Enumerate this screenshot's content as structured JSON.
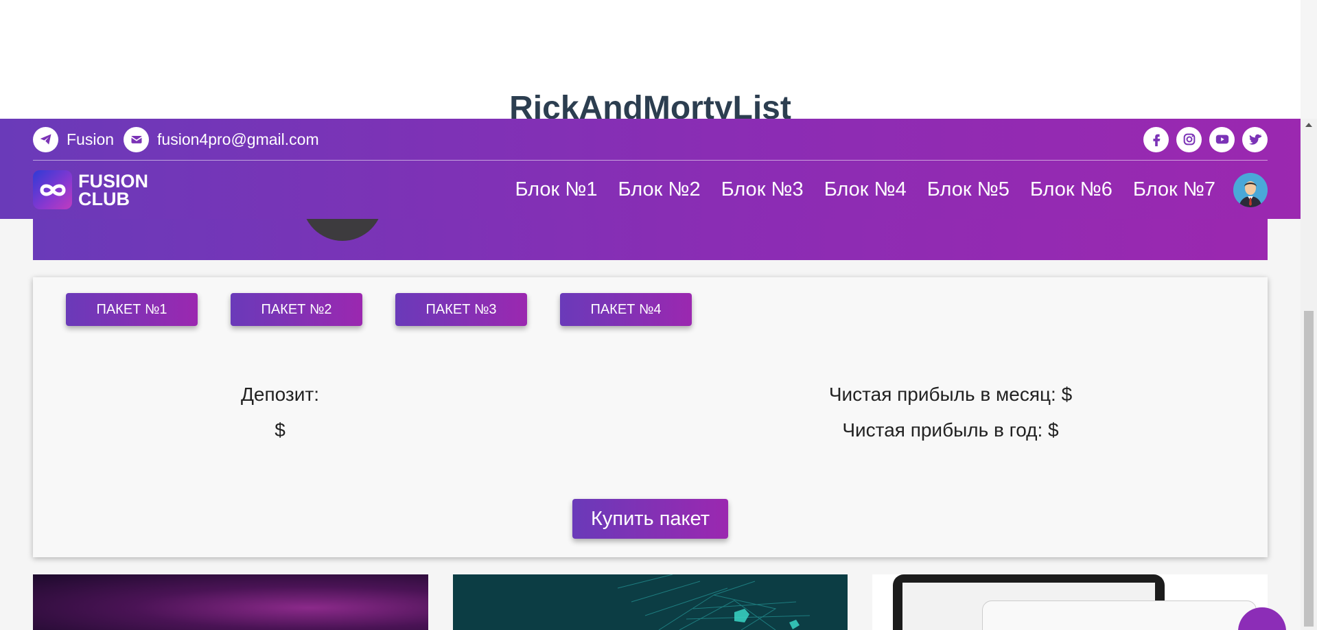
{
  "page": {
    "heading": "RickAndMortyList"
  },
  "header": {
    "telegram_label": "Fusion",
    "email": "fusion4pro@gmail.com",
    "logo_line1": "FUSION",
    "logo_line2": "CLUB",
    "nav": [
      "Блок №1",
      "Блок №2",
      "Блок №3",
      "Блок №4",
      "Блок №5",
      "Блок №6",
      "Блок №7"
    ],
    "socials": [
      "facebook-icon",
      "instagram-icon",
      "youtube-icon",
      "twitter-icon"
    ]
  },
  "packages": {
    "tabs": [
      "ПАКЕТ №1",
      "ПАКЕТ №2",
      "ПАКЕТ №3",
      "ПАКЕТ №4"
    ],
    "deposit_label": "Депозит:",
    "deposit_value": "$",
    "profit_month": "Чистая прибыль в месяц: $",
    "profit_year": "Чистая прибыль в год: $",
    "buy_label": "Купить пакет"
  },
  "colors": {
    "accent_start": "#6a3ab9",
    "accent_end": "#9b28b0",
    "heading": "#2c3e50"
  }
}
